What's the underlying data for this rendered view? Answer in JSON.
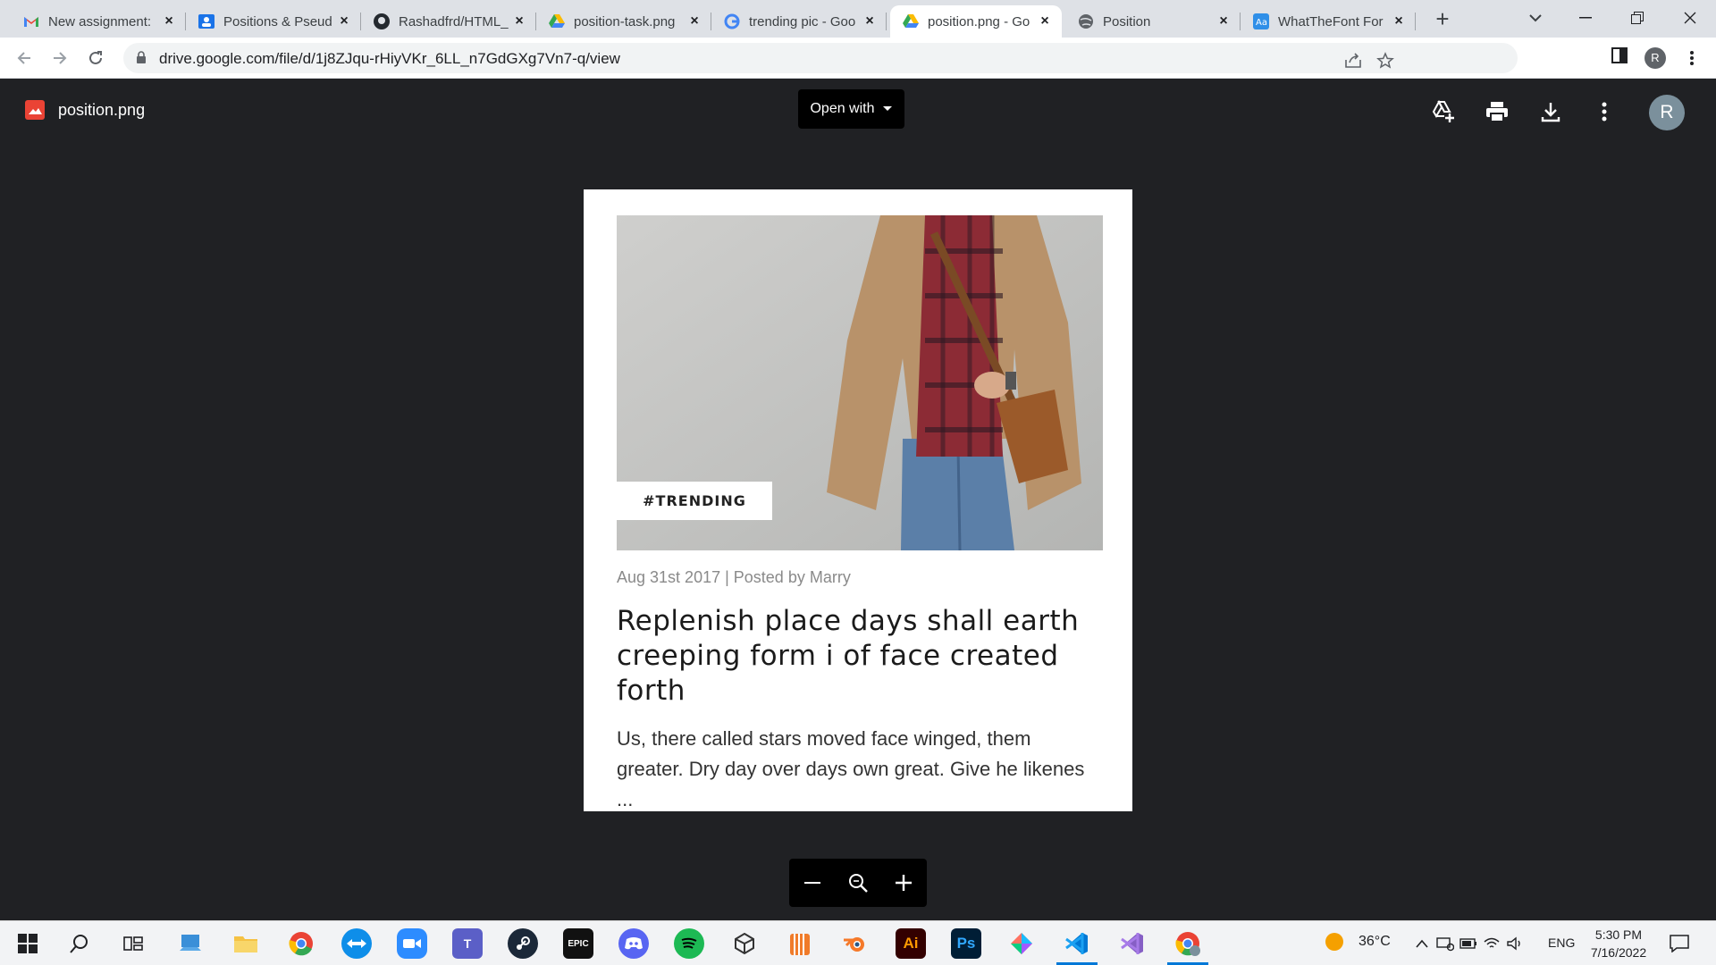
{
  "tabs": [
    {
      "title": "New assignment:",
      "icon": "gmail-icon"
    },
    {
      "title": "Positions & Pseud",
      "icon": "classroom-icon"
    },
    {
      "title": "Rashadfrd/HTML_",
      "icon": "github-icon"
    },
    {
      "title": "position-task.png",
      "icon": "drive-icon"
    },
    {
      "title": "trending pic - Goo",
      "icon": "google-icon"
    },
    {
      "title": "position.png - Go",
      "icon": "drive-icon",
      "active": true
    },
    {
      "title": "Position",
      "icon": "globe-icon"
    },
    {
      "title": "WhatTheFont For",
      "icon": "whatthefont-icon"
    }
  ],
  "address_bar": {
    "url": "drive.google.com/file/d/1j8ZJqu-rHiyVKr_6LL_n7GdGXg7Vn7-q/view",
    "profile_initial": "R"
  },
  "viewer": {
    "file_name": "position.png",
    "open_with_label": "Open with",
    "avatar_initial": "R"
  },
  "document": {
    "tag": "#TRENDING",
    "meta": "Aug 31st 2017 | Posted by Marry",
    "title": "Replenish place days shall earth creeping form i of face created forth",
    "body": "Us, there called stars moved face winged, them greater. Dry day over days own great. Give he likenes ..."
  },
  "zoom": {
    "minus": "–",
    "plus": "+"
  },
  "taskbar": {
    "weather": "36°C",
    "language": "ENG",
    "time": "5:30 PM",
    "date": "7/16/2022"
  },
  "colors": {
    "viewer_bg": "#202124",
    "tabstrip_bg": "#dee1e6",
    "accent": "#0078d7"
  }
}
